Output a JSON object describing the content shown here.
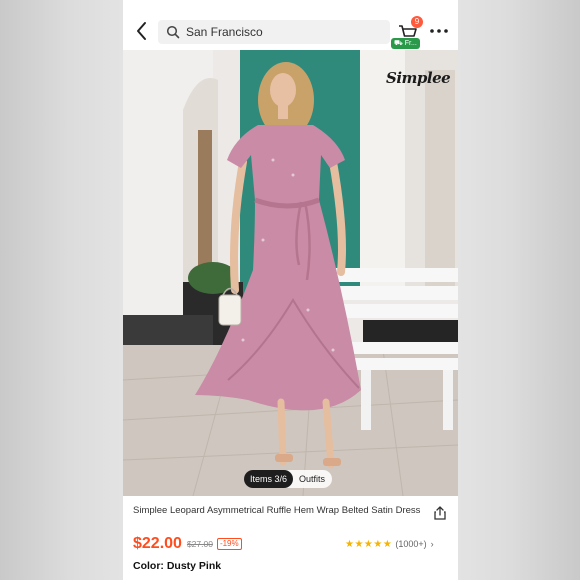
{
  "header": {
    "search": {
      "value": "San Francisco",
      "icon": "search-icon"
    },
    "cart": {
      "badge_count": "9",
      "icon": "cart-icon"
    },
    "free_shipping_tag": "⛟ Fr...",
    "back_icon": "chevron-left-icon",
    "more_icon": "more-dots-icon"
  },
  "product_image": {
    "brand_logo": "Simplee",
    "tabs": {
      "active": "Items 3/6",
      "other": "Outfits"
    }
  },
  "product": {
    "title": "Simplee Leopard Asymmetrical Ruffle Hem Wrap Belted Satin Dress",
    "price": "$22.00",
    "original_price": "$27.00",
    "discount": "-19%",
    "rating": {
      "stars": "★★★★★",
      "count": "(1000+)",
      "chevron": "›",
      "value_stars": 4.5
    },
    "color_label": "Color: Dusty Pink"
  },
  "colors": {
    "price": "#ff4d1f",
    "star": "#f6b400",
    "badge": "#ff5a3c",
    "free_tag": "#2a9a4a",
    "dress": "#c98ba5"
  }
}
